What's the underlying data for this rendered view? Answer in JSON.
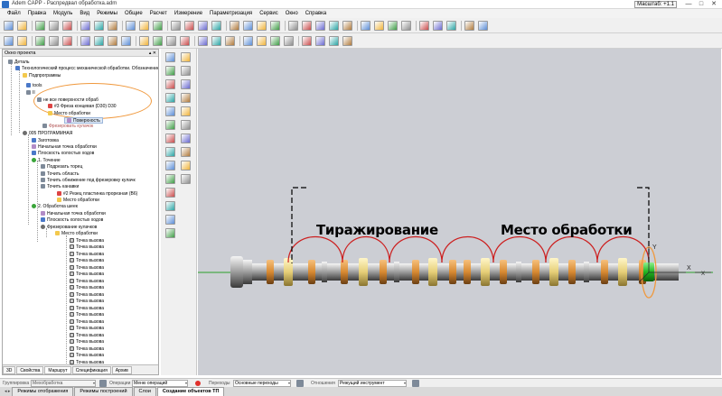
{
  "window": {
    "title": "Adem CAPP - Распредвал обработка.adm",
    "zoom_label": "Масштаб: +1.1",
    "minimize": "—",
    "maximize": "□",
    "close": "✕"
  },
  "menu": [
    "Файл",
    "Правка",
    "Модуль",
    "Вид",
    "Режимы",
    "Общие",
    "Расчет",
    "Измерение",
    "Параметризация",
    "Сервис",
    "Окно",
    "Справка"
  ],
  "project_panel": {
    "title": "Окно проекта",
    "controls": "▴ ✕",
    "tree": [
      {
        "text": "Деталь",
        "icon": "part-icon"
      },
      {
        "text": "Технологический процесс механической обработки. Обозначение",
        "icon": "process-icon"
      },
      {
        "text": "Подпрограммы",
        "icon": "folder-icon"
      },
      {
        "text": "tools",
        "icon": "tools-icon"
      },
      {
        "text": "II",
        "icon": "program-icon"
      },
      {
        "text": "не все поверхности обраб",
        "icon": "operation-icon"
      },
      {
        "text": "#3 Фреза концевая (D30) D30",
        "icon": "tool-icon"
      },
      {
        "text": "Место обработки",
        "icon": "folder-icon"
      },
      {
        "text": "Поверхность",
        "icon": "surface-icon"
      },
      {
        "text": "Фрезеровать кулачок",
        "icon": "operation-icon"
      },
      {
        "text": "005 ПРОГРАММНАЯ",
        "icon": "operation-icon"
      },
      {
        "text": "Заготовка",
        "icon": "blank-icon"
      },
      {
        "text": "Начальная точка обработки",
        "icon": "start-point-icon"
      },
      {
        "text": "Плоскость холостых ходов",
        "icon": "plane-icon"
      },
      {
        "text": "1. Точение",
        "icon": "turning-icon"
      },
      {
        "text": "Подрезать торец",
        "icon": "step-icon"
      },
      {
        "text": "Точить область",
        "icon": "step-icon"
      },
      {
        "text": "Точить обнижение под фрезеровку кулачк",
        "icon": "step-icon"
      },
      {
        "text": "Точить канавки",
        "icon": "step-icon"
      },
      {
        "text": "#2 Резец пластинка прорезная (B6)",
        "icon": "tool-icon"
      },
      {
        "text": "Место обработки",
        "icon": "folder-icon"
      },
      {
        "text": "2. Обработка шеек",
        "icon": "turning-icon"
      },
      {
        "text": "Начальная точка обработки",
        "icon": "start-point-icon"
      },
      {
        "text": "Плоскость холостых ходов",
        "icon": "plane-icon"
      },
      {
        "text": "Фрезерование кулачков",
        "icon": "milling-icon"
      },
      {
        "text": "Место обработки",
        "icon": "folder-icon"
      },
      {
        "text": "Точка вызова",
        "icon": "call-point-icon"
      },
      {
        "text": "Точка вызова",
        "icon": "call-point-icon"
      },
      {
        "text": "Точка вызова",
        "icon": "call-point-icon"
      },
      {
        "text": "Точка вызова",
        "icon": "call-point-icon"
      },
      {
        "text": "Точка вызова",
        "icon": "call-point-icon"
      },
      {
        "text": "Точка вызова",
        "icon": "call-point-icon"
      },
      {
        "text": "Точка вызова",
        "icon": "call-point-icon"
      },
      {
        "text": "Точка вызова",
        "icon": "call-point-icon"
      },
      {
        "text": "Точка вызова",
        "icon": "call-point-icon"
      },
      {
        "text": "Точка вызова",
        "icon": "call-point-icon"
      },
      {
        "text": "Точка вызова",
        "icon": "call-point-icon"
      },
      {
        "text": "Точка вызова",
        "icon": "call-point-icon"
      },
      {
        "text": "Точка вызова",
        "icon": "call-point-icon"
      },
      {
        "text": "Точка вызова",
        "icon": "call-point-icon"
      },
      {
        "text": "Точка вызова",
        "icon": "call-point-icon"
      },
      {
        "text": "Точка вызова",
        "icon": "call-point-icon"
      },
      {
        "text": "Точка вызова",
        "icon": "call-point-icon"
      },
      {
        "text": "Точка вызова",
        "icon": "call-point-icon"
      },
      {
        "text": "Точка вызова",
        "icon": "call-point-icon"
      },
      {
        "text": "Точка вызова",
        "icon": "call-point-icon"
      }
    ],
    "tabs": [
      "3D",
      "Свойства",
      "Маршрут",
      "Спецификация",
      "Архив"
    ]
  },
  "viewport": {
    "label_replication": "Тиражирование",
    "label_machining_place": "Место обработки",
    "axis_x": "X",
    "axis_y": "Y",
    "arc_color": "#cc1f1f",
    "highlight_color": "#f0993e"
  },
  "status_bar": {
    "group_label": "Группировка",
    "group_value": "Мехобработка",
    "operations_label": "Операции",
    "operations_value": "Меню операций",
    "transitions_label": "Переходы",
    "transitions_value": "Основные переходы",
    "display_label": "Отношения",
    "display_value": "Режущий инструмент"
  },
  "bottom_tabs": [
    "Режимы отображения",
    "Режимы построений",
    "Слои",
    "Создание объектов ТП"
  ],
  "bottom_tab_nav": "◂ ▸"
}
